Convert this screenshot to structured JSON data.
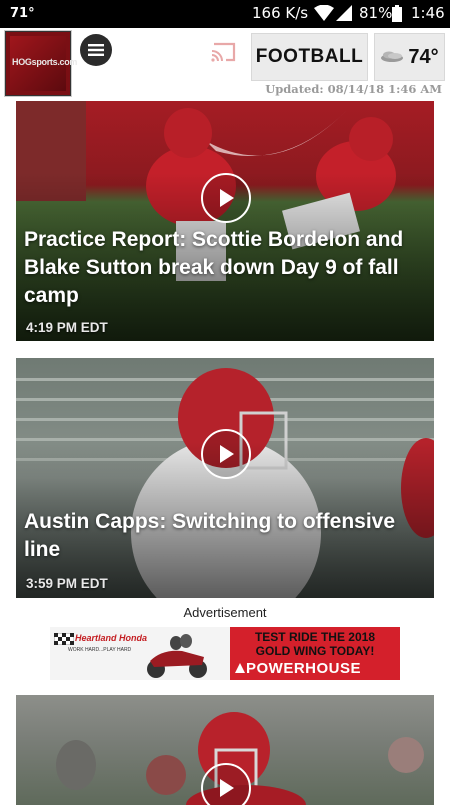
{
  "status_bar": {
    "left_temp": "71°",
    "speed": "166 K/s",
    "battery": "81%",
    "time": "1:46"
  },
  "header": {
    "logo_text_prefix": "HOG",
    "logo_text_suffix": "sports.com",
    "section_button": "FOOTBALL",
    "weather_temp": "74°",
    "updated": "Updated: 08/14/18 1:46 AM"
  },
  "articles": [
    {
      "headline": "Practice Report: Scottie Bordelon and Blake Sutton break down Day 9 of fall camp",
      "time": "4:19 PM EDT"
    },
    {
      "headline": "Austin Capps: Switching to offensive line",
      "time": "3:59 PM EDT"
    },
    {
      "headline": "",
      "time": ""
    }
  ],
  "advertisement": {
    "label": "Advertisement",
    "dealer_name": "Heartland Honda",
    "dealer_tagline": "WORK HARD...PLAY HARD",
    "line1": "TEST RIDE THE 2018",
    "line2": "GOLD WING TODAY!",
    "line3": "POWERHOUSE"
  },
  "icons": {
    "menu": "menu-icon",
    "cast": "cast-icon",
    "weather": "cloud-icon",
    "play": "play-icon"
  },
  "colors": {
    "brand_red": "#9d1c20",
    "cast_icon": "#e8a8a8",
    "ad_red": "#d4202b"
  }
}
